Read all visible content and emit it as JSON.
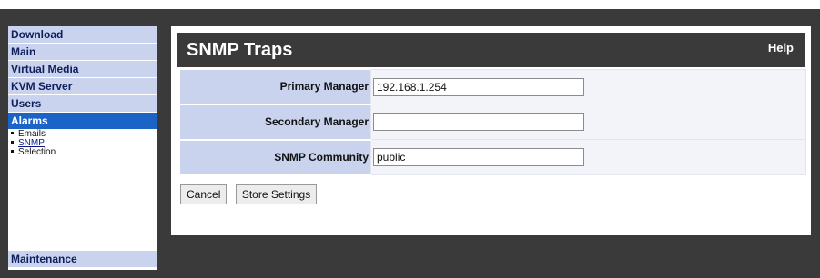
{
  "sidebar": {
    "items": [
      {
        "label": "Download",
        "active": false
      },
      {
        "label": "Main",
        "active": false
      },
      {
        "label": "Virtual Media",
        "active": false
      },
      {
        "label": "KVM Server",
        "active": false
      },
      {
        "label": "Users",
        "active": false
      },
      {
        "label": "Alarms",
        "active": true
      }
    ],
    "subitems": [
      {
        "label": "Emails",
        "current": false
      },
      {
        "label": "SNMP",
        "current": true
      },
      {
        "label": "Selection",
        "current": false
      }
    ],
    "maintenance_label": "Maintenance"
  },
  "main": {
    "title": "SNMP Traps",
    "help_label": "Help",
    "fields": [
      {
        "label": "Primary Manager",
        "value": "192.168.1.254"
      },
      {
        "label": "Secondary Manager",
        "value": ""
      },
      {
        "label": "SNMP Community",
        "value": "public"
      }
    ],
    "cancel_label": "Cancel",
    "store_label": "Store Settings"
  },
  "colors": {
    "background_dark": "#3a3a3a",
    "nav_item": "#c9d3ee",
    "nav_active": "#1c63c7",
    "nav_text": "#0f1f5c"
  }
}
